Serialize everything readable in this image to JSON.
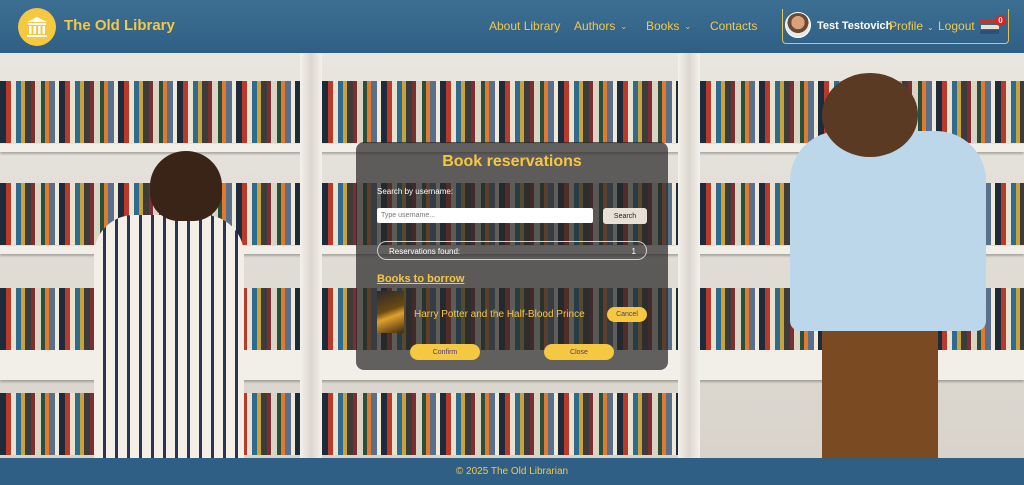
{
  "header": {
    "brand": "The Old Library",
    "logo_icon": "library-building-icon",
    "nav": [
      {
        "label": "About Library",
        "has_dropdown": false
      },
      {
        "label": "Authors",
        "has_dropdown": true
      },
      {
        "label": "Books",
        "has_dropdown": true
      },
      {
        "label": "Contacts",
        "has_dropdown": false
      }
    ],
    "user": {
      "name": "Test Testovich",
      "profile_label": "Profile",
      "logout_label": "Logout",
      "cart_count": "0"
    }
  },
  "modal": {
    "title": "Book reservations",
    "search_label": "Search by username:",
    "search_placeholder": "Type username...",
    "search_button": "Search",
    "found_label": "Reservations found:",
    "found_count": "1",
    "borrow_heading": "Books to borrow",
    "books": [
      {
        "title": "Harry Potter and the Half-Blood Prince",
        "cancel_label": "Cancel"
      }
    ],
    "confirm_label": "Confirm",
    "close_label": "Close"
  },
  "footer": {
    "copyright": "© 2025 The Old Librarian"
  },
  "colors": {
    "header_bg": "#2f5f84",
    "accent": "#f5c842",
    "modal_bg": "rgba(40,40,40,0.72)",
    "badge": "#dd2222"
  }
}
